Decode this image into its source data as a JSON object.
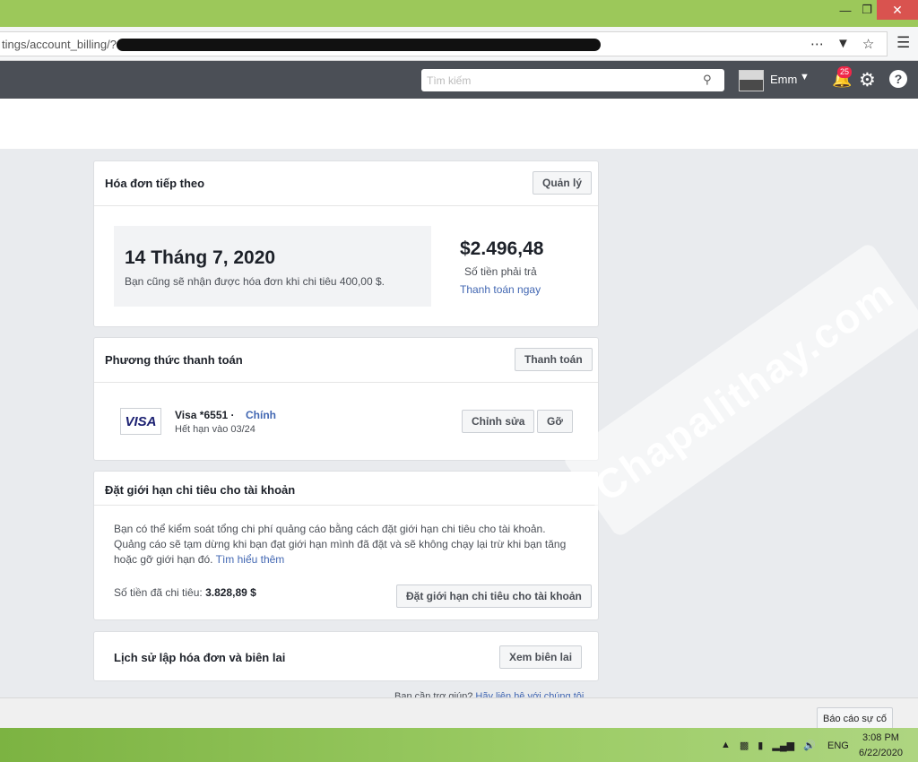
{
  "url": {
    "text": "tings/account_billing/?a"
  },
  "fb": {
    "search_placeholder": "Tìm kiếm",
    "user_name": "Emm",
    "notification_count": "25"
  },
  "next_bill": {
    "title": "Hóa đơn tiếp theo",
    "manage_label": "Quản lý",
    "due_date": "14 Tháng 7, 2020",
    "note": "Bạn cũng sẽ nhận được hóa đơn khi chi tiêu 400,00 $.",
    "amount": "$2.496,48",
    "amount_label": "Số tiền phải trả",
    "pay_now": "Thanh toán ngay"
  },
  "payment_method": {
    "title": "Phương thức thanh toán",
    "pay_label": "Thanh toán",
    "visa_logo": "VISA",
    "card_number": "Visa *6551 ·",
    "card_primary": "Chính",
    "expiry": "Hết hạn vào 03/24",
    "edit_label": "Chỉnh sửa",
    "remove_label": "Gỡ"
  },
  "spending_limit": {
    "title": "Đặt giới hạn chi tiêu cho tài khoản",
    "description": "Bạn có thể kiểm soát tổng chi phí quảng cáo bằng cách đặt giới hạn chi tiêu cho tài khoản. Quảng cáo sẽ tạm dừng khi bạn đạt giới hạn mình đã đặt và sẽ không chạy lại trừ khi bạn tăng hoặc gỡ giới hạn đó.",
    "learn_more": "Tìm hiểu thêm",
    "spent_label": "Số tiền đã chi tiêu:",
    "spent_value": "3.828,89 $",
    "set_limit_label": "Đặt giới hạn chi tiêu cho tài khoản"
  },
  "billing_history": {
    "title": "Lịch sử lập hóa đơn và biên lai",
    "view_receipts": "Xem biên lai"
  },
  "help": {
    "question": "Bạn cần trợ giúp?",
    "contact": "Hãy liên hệ với chúng tôi"
  },
  "report_label": "Báo cáo sự cố",
  "taskbar": {
    "lang": "ENG",
    "time": "3:08 PM",
    "date": "6/22/2020"
  },
  "watermark": "Chapalithay.com"
}
